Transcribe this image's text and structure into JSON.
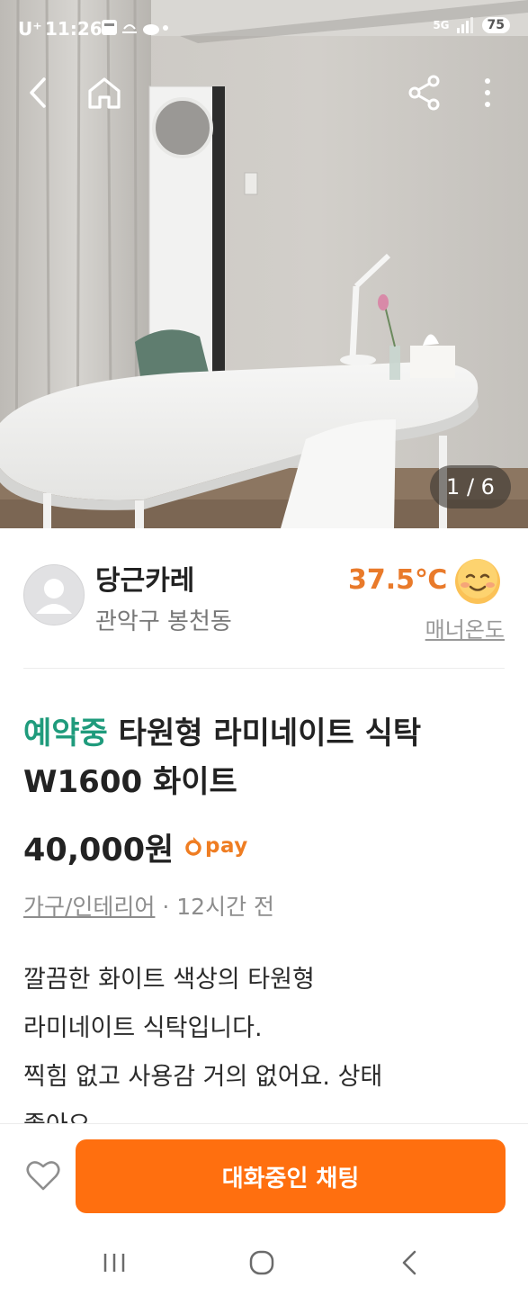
{
  "status_bar": {
    "carrier": "U⁺",
    "time": "11:26",
    "icons": [
      "notification-icons",
      "weather-icon",
      "dot"
    ],
    "network": "5G",
    "battery": "75"
  },
  "top_nav": {
    "icons": [
      "back-icon",
      "home-icon",
      "share-icon",
      "more-vertical-icon"
    ]
  },
  "gallery": {
    "counter": "1 / 6"
  },
  "seller": {
    "name": "당근카레",
    "location": "관악구 봉천동",
    "temperature": "37.5℃",
    "manner_label": "매너온도",
    "temperature_color": "#e97a2a"
  },
  "listing": {
    "status": "예약중",
    "title": " 타원형 라미네이트 식탁 W1600 화이트",
    "price": "40,000원",
    "pay_label": "pay",
    "category": "가구/인테리어",
    "time_ago": " · 12시간 전",
    "description_lines": [
      "깔끔한 화이트 색상의  타원형",
      "라미네이트 식탁입니다.",
      "찍힘 없고 사용감 거의 없어요. 상태",
      "좋아요."
    ],
    "status_color": "#1f9b7c"
  },
  "bottom_bar": {
    "chat_button_label": "대화중인 채팅",
    "accent_color": "#ff6f0f"
  },
  "system_nav": {
    "icons": [
      "recents-icon",
      "home-circle-icon",
      "back-chevron-icon"
    ]
  }
}
